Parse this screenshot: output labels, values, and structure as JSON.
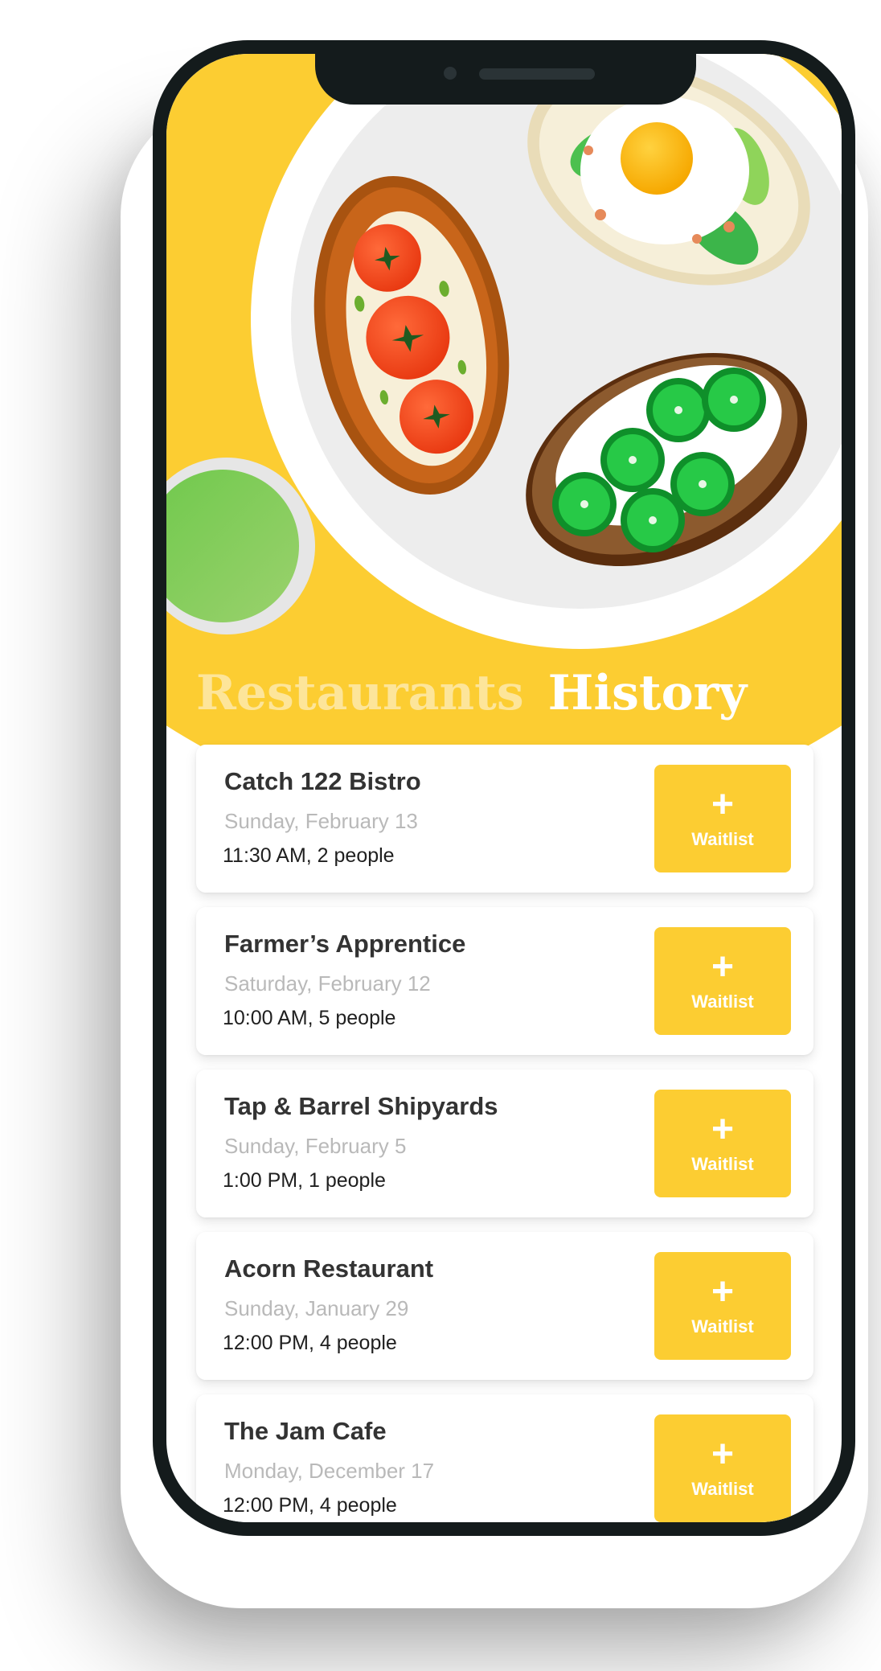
{
  "colors": {
    "accent": "#fccd32",
    "phone_frame": "#141b1c",
    "date_text": "#b9b9b9"
  },
  "header": {
    "tabs": [
      {
        "label": "Restaurants",
        "active": false
      },
      {
        "label": "History",
        "active": true
      }
    ]
  },
  "history": {
    "items": [
      {
        "name": "Catch 122 Bistro",
        "date": "Sunday, February 13",
        "details": "11:30 AM, 2 people",
        "action_icon": "+",
        "action_label": "Waitlist"
      },
      {
        "name": "Farmer’s Apprentice",
        "date": "Saturday, February 12",
        "details": "10:00 AM, 5 people",
        "action_icon": "+",
        "action_label": "Waitlist"
      },
      {
        "name": "Tap & Barrel Shipyards",
        "date": "Sunday, February 5",
        "details": "1:00 PM, 1 people",
        "action_icon": "+",
        "action_label": "Waitlist"
      },
      {
        "name": "Acorn Restaurant",
        "date": "Sunday, January 29",
        "details": "12:00 PM, 4 people",
        "action_icon": "+",
        "action_label": "Waitlist"
      },
      {
        "name": "The Jam Cafe",
        "date": "Monday, December 17",
        "details": "12:00 PM, 4 people",
        "action_icon": "+",
        "action_label": "Waitlist"
      }
    ]
  },
  "hero": {
    "illustration": "plate-of-toasts-illustration"
  }
}
